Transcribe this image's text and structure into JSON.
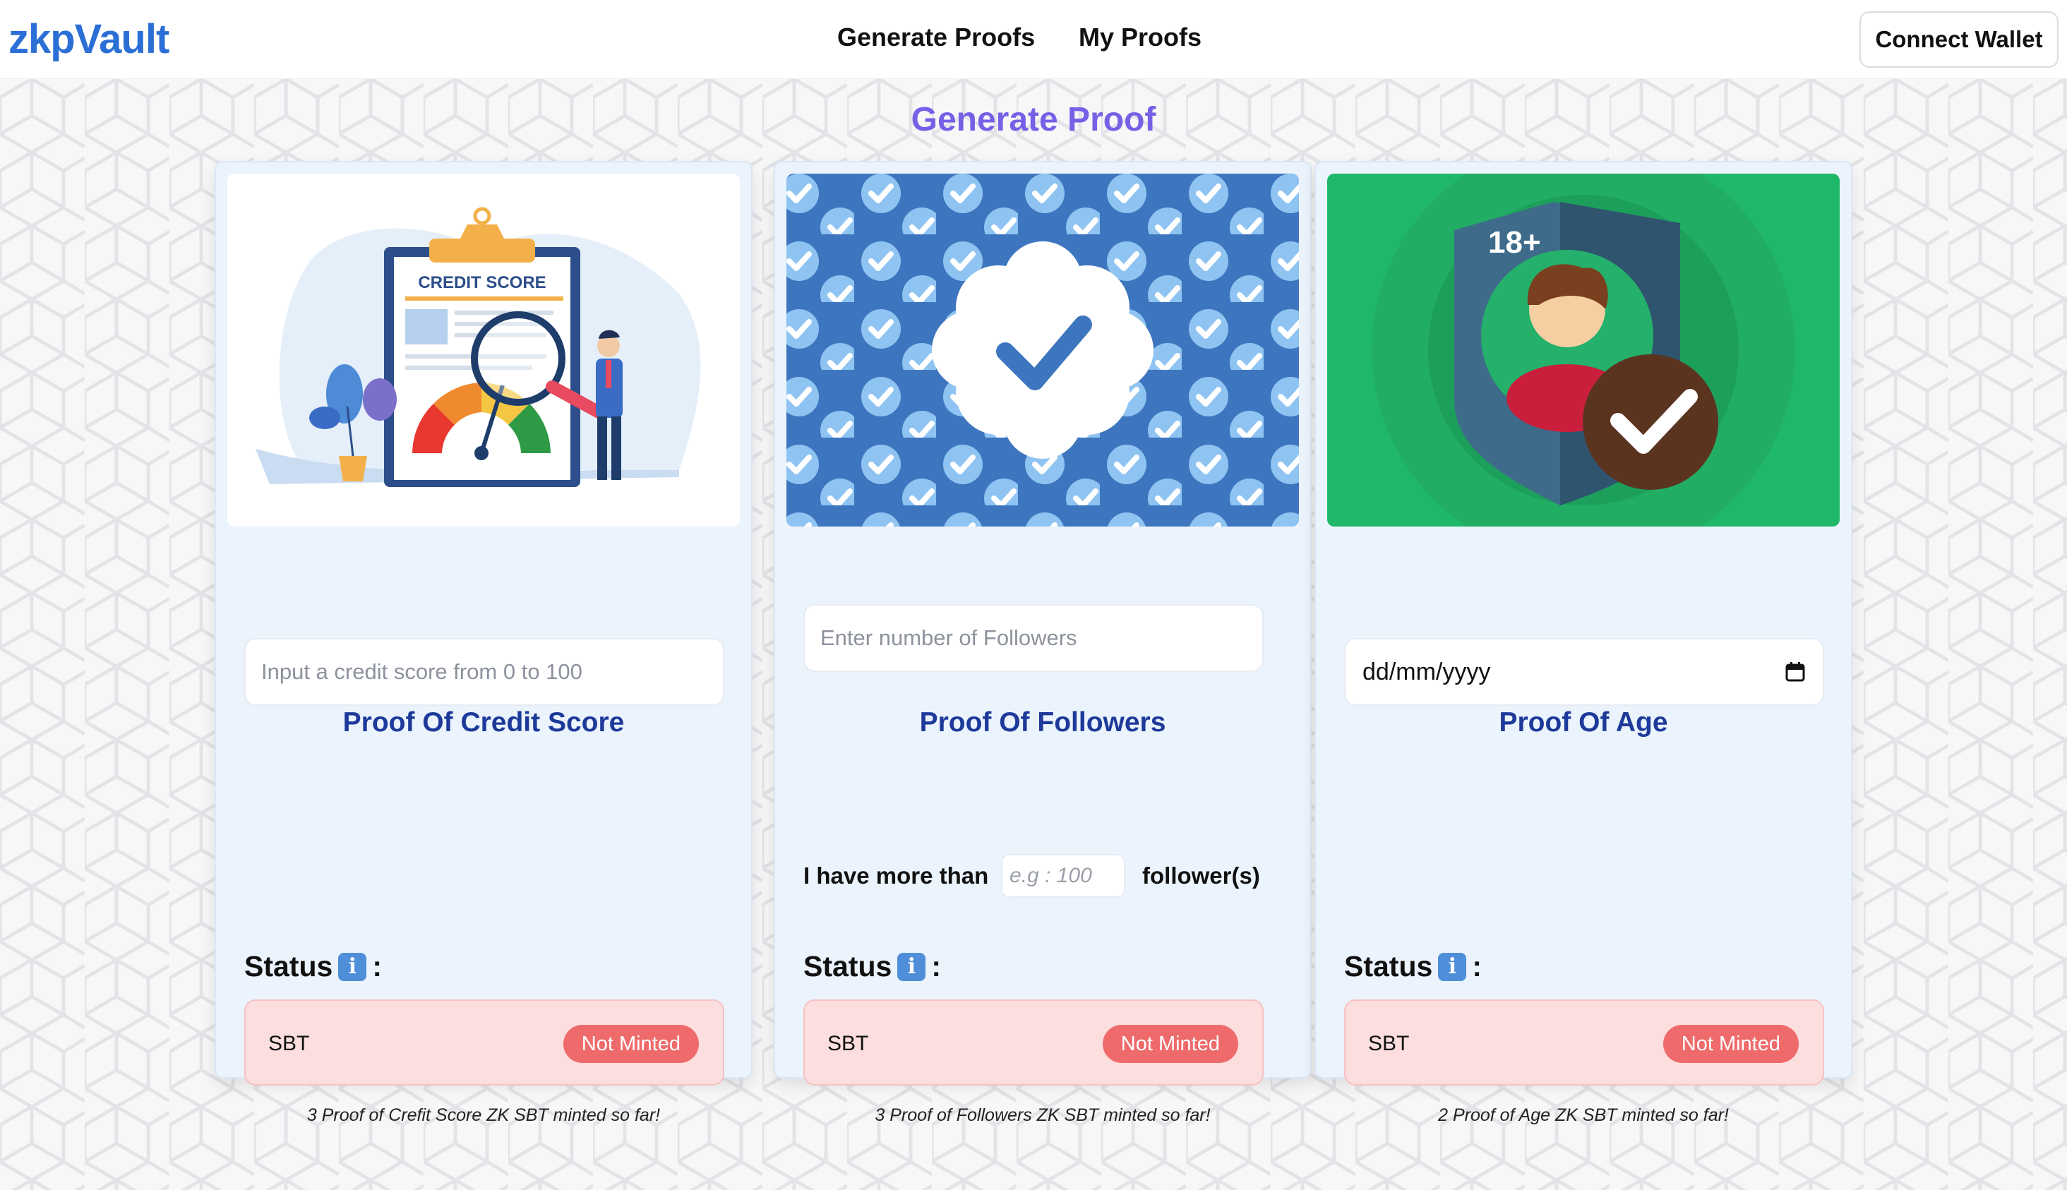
{
  "nav": {
    "brand": "zkpVault",
    "links": [
      "Generate Proofs",
      "My Proofs"
    ],
    "connect_label": "Connect Wallet"
  },
  "page": {
    "heading": "Generate Proof"
  },
  "cards": [
    {
      "title": "Proof Of Credit Score",
      "image_text": "CREDIT SCORE",
      "input_placeholder": "Input a credit score from 0 to 100",
      "status_label": "Status",
      "status_suffix": ":",
      "sbt_label": "SBT",
      "badge": "Not Minted",
      "note": "3 Proof of Crefit Score ZK SBT minted so far!"
    },
    {
      "title": "Proof Of Followers",
      "input_placeholder": "Enter number of Followers",
      "prefix_label": "I have more than",
      "small_placeholder": "e.g : 100",
      "suffix_label": "follower(s)",
      "status_label": "Status",
      "status_suffix": ":",
      "sbt_label": "SBT",
      "badge": "Not Minted",
      "note": "3 Proof of Followers ZK SBT minted so far!"
    },
    {
      "title": "Proof Of Age",
      "image_text": "18+",
      "date_value": "dd/mm/yyyy",
      "status_label": "Status",
      "status_suffix": ":",
      "sbt_label": "SBT",
      "badge": "Not Minted",
      "note": "2 Proof of Age ZK SBT minted so far!"
    }
  ],
  "icons": {
    "info": "info-icon",
    "calendar": "calendar-icon",
    "verified": "verified-badge-icon"
  },
  "colors": {
    "brand": "#2b6fd6",
    "heading": "#7461e6",
    "card_title": "#1d3a9a",
    "badge": "#ef6b6b",
    "status_bg": "#fcdede"
  }
}
